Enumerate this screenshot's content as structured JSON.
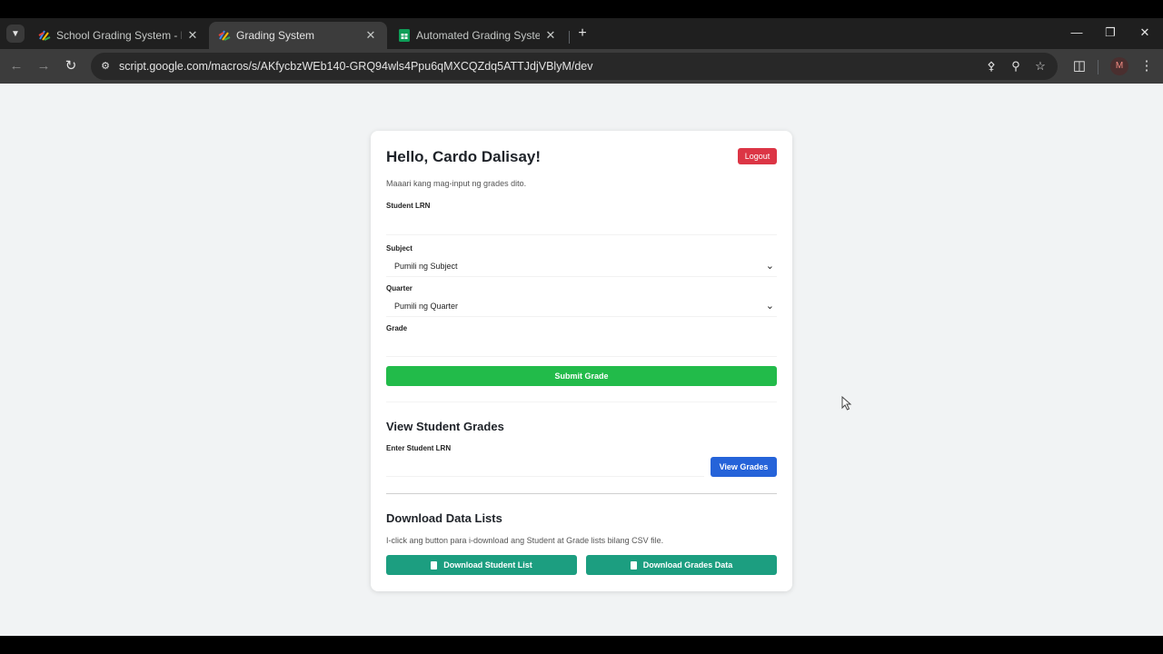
{
  "browser": {
    "tabs": [
      {
        "title": "School Grading System - Projec",
        "active": false
      },
      {
        "title": "Grading System",
        "active": true
      },
      {
        "title": "Automated Grading System Pu",
        "active": false
      }
    ],
    "url": "script.google.com/macros/s/AKfycbzWEb140-GRQ94wls4Ppu6qMXCQZdq5ATTJdjVBlyM/dev",
    "profile_initial": "M"
  },
  "form": {
    "greeting": "Hello, Cardo Dalisay!",
    "logout_label": "Logout",
    "subtitle": "Maaari kang mag-input ng grades dito.",
    "lrn_label": "Student LRN",
    "subject_label": "Subject",
    "subject_selected": "Pumili ng Subject",
    "quarter_label": "Quarter",
    "quarter_selected": "Pumili ng Quarter",
    "grade_label": "Grade",
    "submit_label": "Submit Grade"
  },
  "view": {
    "heading": "View Student Grades",
    "lrn_label": "Enter Student LRN",
    "button_label": "View Grades"
  },
  "download": {
    "heading": "Download Data Lists",
    "note": "I-click ang button para i-download ang Student at Grade lists bilang CSV file.",
    "student_button": "Download Student List",
    "grades_button": "Download Grades Data"
  },
  "colors": {
    "logout": "#dc3545",
    "submit": "#22bb4a",
    "view": "#2563d9",
    "download": "#1c9e80"
  }
}
